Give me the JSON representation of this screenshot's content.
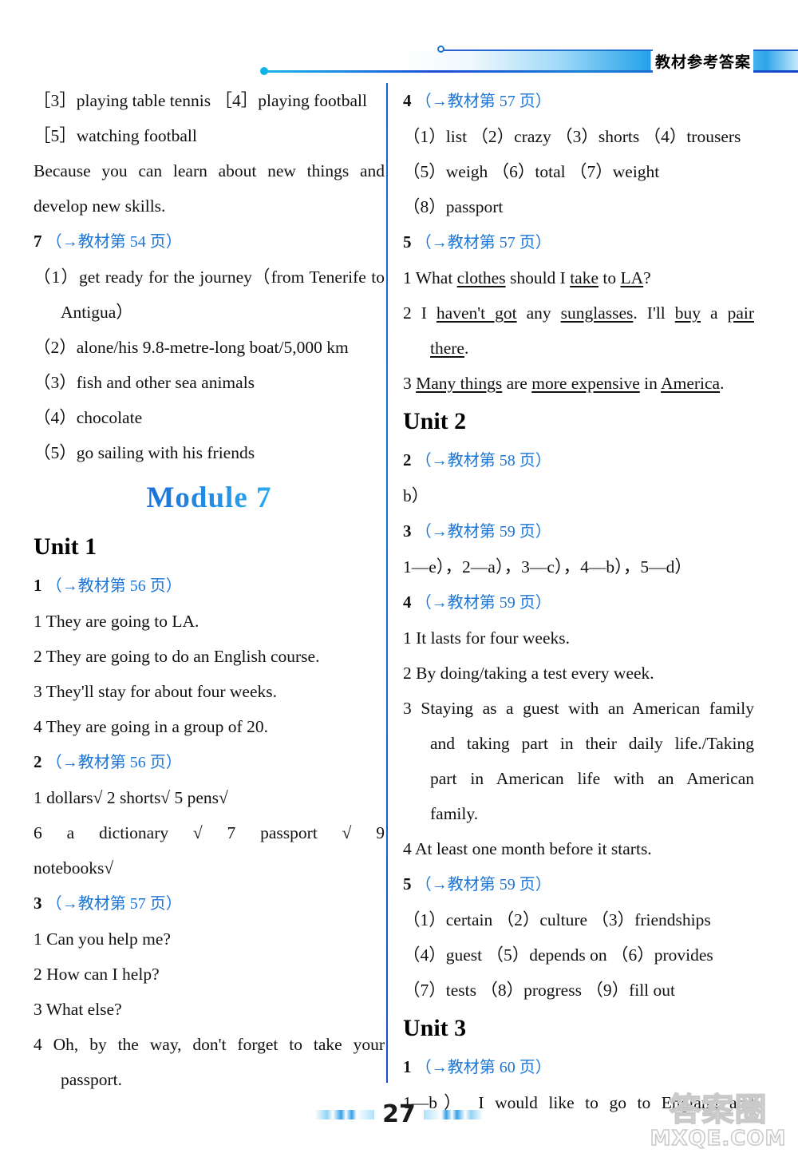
{
  "header": {
    "title": "教材参考答案"
  },
  "footer": {
    "page_number": "27"
  },
  "watermark": {
    "cn": "答案圈",
    "en": "MXQE.COM"
  },
  "left_column": {
    "top_lines": [
      "［3］playing table tennis  ［4］playing football",
      "［5］watching football"
    ],
    "because_line_1": "Because you can learn about new things and",
    "because_line_2": "develop new skills.",
    "section7": {
      "num": "7",
      "ref": "（→教材第 54 页）",
      "items": [
        "（1）get ready for the journey（from Tenerife to",
        "Antigua）",
        "（2）alone/his 9.8-metre-long boat/5,000 km",
        "（3）fish and other sea animals",
        "（4）chocolate",
        "（5）go sailing with his friends"
      ]
    },
    "module_title": "Module 7",
    "unit1_title": "Unit 1",
    "section1": {
      "num": "1",
      "ref": "（→教材第 56 页）",
      "items": [
        "1 They are going to LA.",
        "2 They are going to do an English course.",
        "3 They'll stay for about four weeks.",
        "4 They are going in a group of 20."
      ]
    },
    "section2": {
      "num": "2",
      "ref": "（→教材第 56 页）",
      "line1": "1 dollars√   2 shorts√   5 pens√",
      "line2": "6 a dictionary √ 7 passport √ 9",
      "line3": "notebooks√"
    },
    "section3": {
      "num": "3",
      "ref": "（→教材第 57 页）",
      "items": [
        "1 Can you help me?",
        "2 How can I help?",
        "3 What else?",
        "4 Oh, by the way, don't forget to take your",
        "passport."
      ]
    }
  },
  "right_column": {
    "section4": {
      "num": "4",
      "ref": "（→教材第 57 页）",
      "items": [
        "（1）list  （2）crazy  （3）shorts  （4）trousers",
        "（5）weigh  （6）total  （7）weight",
        "（8）passport"
      ]
    },
    "section5": {
      "num": "5",
      "ref": "（→教材第 57 页）",
      "q1": {
        "prefix": "1 What ",
        "u1": "clothes",
        "mid1": " should I ",
        "u2": "take",
        "mid2": " to ",
        "u3": "LA",
        "suffix": "?"
      },
      "q2": {
        "prefix": "2 I ",
        "u1": "haven't got",
        "mid1": " any ",
        "u2": "sunglasses",
        "mid2": ". I'll ",
        "u3": "buy",
        "mid3": " a ",
        "u4": "pair",
        "cont_u": "there",
        "cont_suffix": "."
      },
      "q3": {
        "u1": "Many things",
        "prefix": "3 ",
        "mid1": " are ",
        "u2": "more expensive",
        "mid2": " in ",
        "u3": "America",
        "suffix": "."
      }
    },
    "unit2_title": "Unit 2",
    "u2_section2": {
      "num": "2",
      "ref": "（→教材第 58 页）",
      "answer": "b）"
    },
    "u2_section3": {
      "num": "3",
      "ref": "（→教材第 59 页）",
      "answer": "1—e），2—a），3—c），4—b），5—d）"
    },
    "u2_section4": {
      "num": "4",
      "ref": "（→教材第 59 页）",
      "items": [
        "1 It lasts for four weeks.",
        "2 By doing/taking a test every week.",
        "3 Staying as a guest with an American family",
        "and taking part in their daily life./Taking",
        "part in American life with an American",
        "family.",
        "4 At least one month before it starts."
      ]
    },
    "u2_section5": {
      "num": "5",
      "ref": "（→教材第 59 页）",
      "items": [
        "（1）certain  （2）culture  （3）friendships",
        "（4）guest  （5）depends on  （6）provides",
        "（7）tests  （8）progress  （9）fill out"
      ]
    },
    "unit3_title": "Unit 3",
    "u3_section1": {
      "num": "1",
      "ref": "（→教材第 60 页）",
      "line1": "1—b） I would like to go to England and"
    }
  }
}
